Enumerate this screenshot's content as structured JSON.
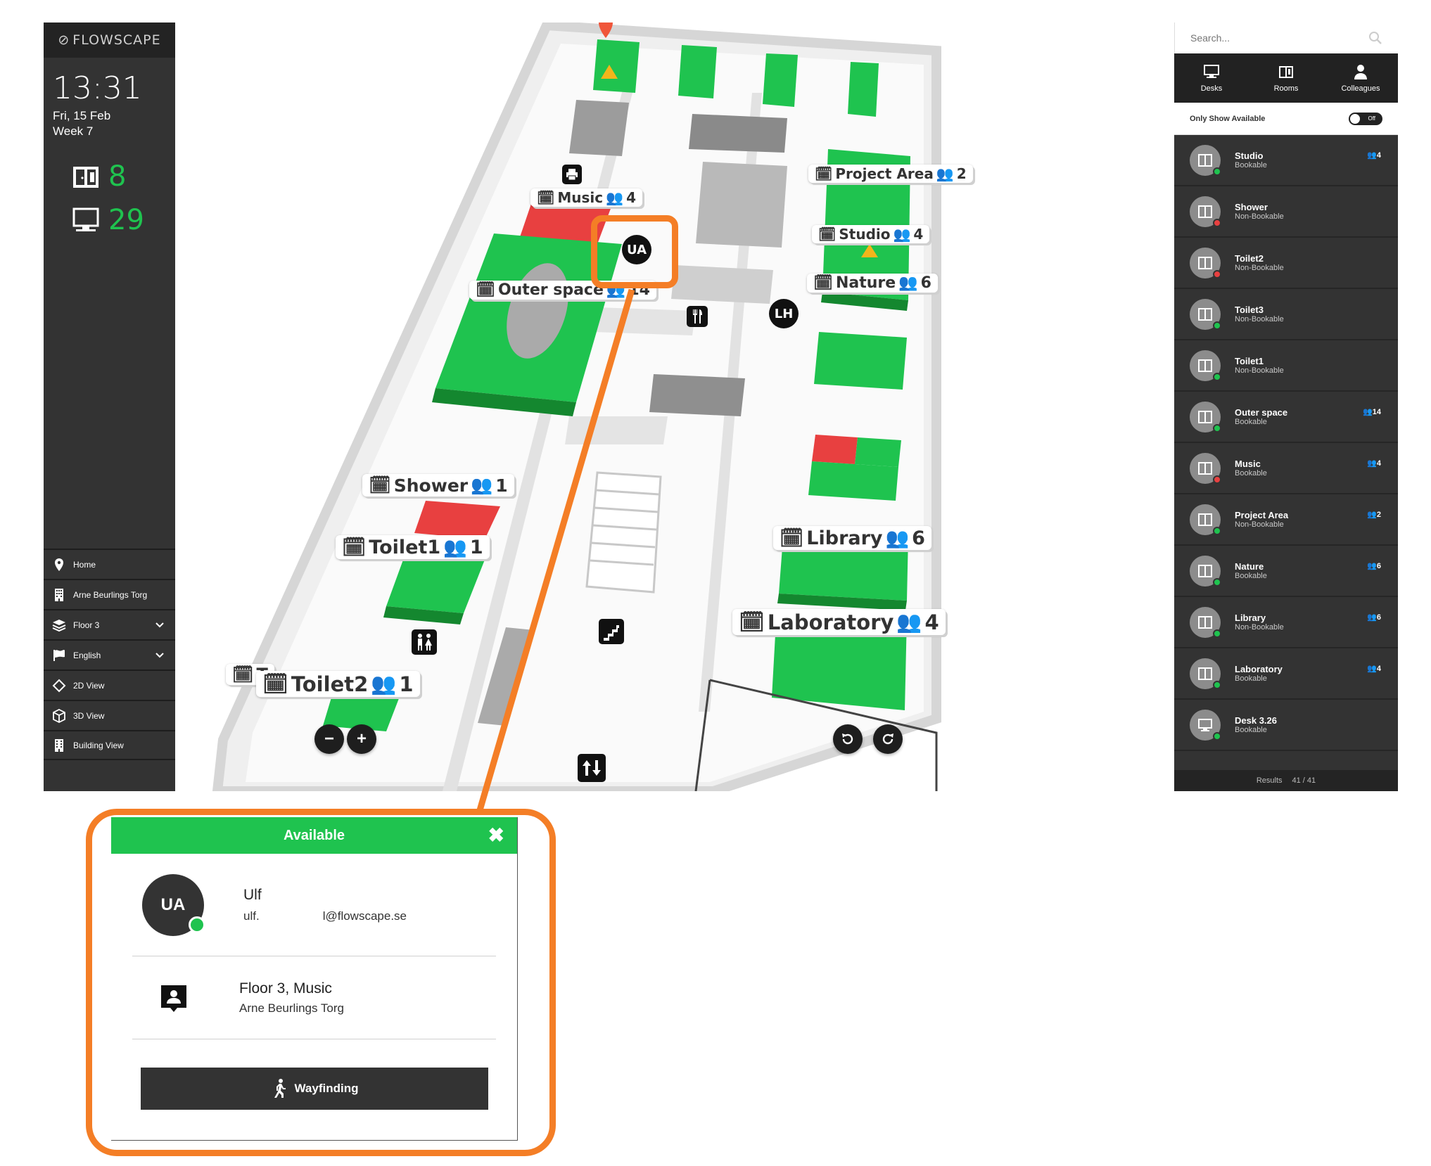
{
  "app": {
    "logo": "FLOWSCAPE"
  },
  "sidebar": {
    "time": "13:31",
    "date": "Fri, 15 Feb",
    "week": "Week 7",
    "rooms_available": "8",
    "desks_available": "29",
    "menu": [
      {
        "label": "Home",
        "icon": "map-pin-icon"
      },
      {
        "label": "Arne Beurlings Torg",
        "icon": "building-icon"
      },
      {
        "label": "Floor 3",
        "icon": "layers-icon"
      },
      {
        "label": "English",
        "icon": "flag-icon"
      },
      {
        "label": "2D View",
        "icon": "square-icon"
      },
      {
        "label": "3D View",
        "icon": "cube-icon"
      },
      {
        "label": "Building View",
        "icon": "building-icon"
      }
    ]
  },
  "map": {
    "labels": [
      {
        "name": "Music",
        "cap": "4"
      },
      {
        "name": "Outer space",
        "cap": "14"
      },
      {
        "name": "Project Area",
        "cap": "2"
      },
      {
        "name": "Studio",
        "cap": "4"
      },
      {
        "name": "Nature",
        "cap": "6"
      },
      {
        "name": "Shower",
        "cap": "1"
      },
      {
        "name": "Toilet1",
        "cap": "1"
      },
      {
        "name": "Library",
        "cap": "6"
      },
      {
        "name": "Laboratory",
        "cap": "4"
      },
      {
        "name": "Toilet2",
        "cap": "1"
      },
      {
        "name": "T",
        "cap": ""
      }
    ],
    "pins": [
      "UA",
      "LH"
    ],
    "zoom_out": "−",
    "zoom_in": "+",
    "colors": {
      "available": "#1fc34f",
      "occupied": "#e84040",
      "accent": "#f47e26"
    }
  },
  "panel": {
    "search_placeholder": "Search...",
    "tabs": [
      "Desks",
      "Rooms",
      "Colleagues"
    ],
    "filter_label": "Only Show Available",
    "toggle_label": "Off",
    "items": [
      {
        "name": "Studio",
        "status": "Bookable",
        "cap": "4",
        "state": "green"
      },
      {
        "name": "Shower",
        "status": "Non-Bookable",
        "cap": "",
        "state": "red"
      },
      {
        "name": "Toilet2",
        "status": "Non-Bookable",
        "cap": "",
        "state": "red"
      },
      {
        "name": "Toilet3",
        "status": "Non-Bookable",
        "cap": "",
        "state": "green"
      },
      {
        "name": "Toilet1",
        "status": "Non-Bookable",
        "cap": "",
        "state": "green"
      },
      {
        "name": "Outer space",
        "status": "Bookable",
        "cap": "14",
        "state": "green"
      },
      {
        "name": "Music",
        "status": "Bookable",
        "cap": "4",
        "state": "red"
      },
      {
        "name": "Project Area",
        "status": "Non-Bookable",
        "cap": "2",
        "state": "green"
      },
      {
        "name": "Nature",
        "status": "Bookable",
        "cap": "6",
        "state": "green"
      },
      {
        "name": "Library",
        "status": "Non-Bookable",
        "cap": "6",
        "state": "green"
      },
      {
        "name": "Laboratory",
        "status": "Bookable",
        "cap": "4",
        "state": "green"
      },
      {
        "name": "Desk 3.26",
        "status": "Bookable",
        "cap": "",
        "state": "green"
      }
    ],
    "results_label": "Results",
    "results_value": "41 / 41"
  },
  "popup": {
    "status": "Available",
    "close": "✖",
    "initials": "UA",
    "name": "Ulf",
    "email_prefix": "ulf.",
    "email_suffix": "l@flowscape.se",
    "location": "Floor 3, Music",
    "building": "Arne Beurlings Torg",
    "wayfinding": "Wayfinding"
  }
}
